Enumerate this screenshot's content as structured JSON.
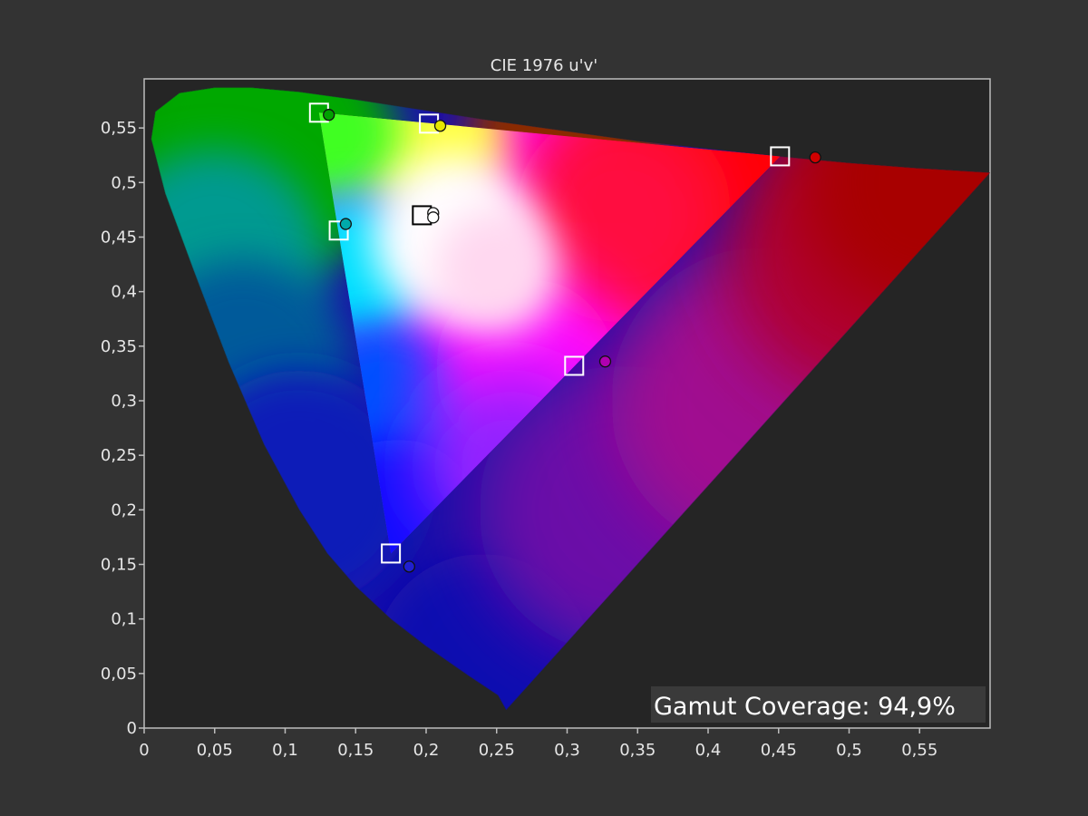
{
  "chart_data": {
    "type": "scatter",
    "title": "CIE 1976 u'v'",
    "xlabel": "",
    "ylabel": "",
    "xlim": [
      0,
      0.6
    ],
    "ylim": [
      0,
      0.595
    ],
    "x_ticks": [
      0,
      0.05,
      0.1,
      0.15,
      0.2,
      0.25,
      0.3,
      0.35,
      0.4,
      0.45,
      0.5,
      0.55
    ],
    "y_ticks": [
      0,
      0.05,
      0.1,
      0.15,
      0.2,
      0.25,
      0.3,
      0.35,
      0.4,
      0.45,
      0.5,
      0.55
    ],
    "x_tick_labels": [
      "0",
      "0,05",
      "0,1",
      "0,15",
      "0,2",
      "0,25",
      "0,3",
      "0,35",
      "0,4",
      "0,45",
      "0,5",
      "0,55"
    ],
    "y_tick_labels": [
      "0",
      "0,05",
      "0,1",
      "0,15",
      "0,2",
      "0,25",
      "0,3",
      "0,35",
      "0,4",
      "0,45",
      "0,5",
      "0,55"
    ],
    "grid": false,
    "background_color": "#333333",
    "plot_background_color": "#252525",
    "spectral_locus": [
      [
        0.2568,
        0.0165
      ],
      [
        0.251,
        0.03
      ],
      [
        0.23,
        0.048
      ],
      [
        0.2,
        0.075
      ],
      [
        0.175,
        0.1
      ],
      [
        0.15,
        0.13
      ],
      [
        0.13,
        0.16
      ],
      [
        0.11,
        0.2
      ],
      [
        0.085,
        0.26
      ],
      [
        0.06,
        0.335
      ],
      [
        0.035,
        0.42
      ],
      [
        0.015,
        0.49
      ],
      [
        0.005,
        0.54
      ],
      [
        0.008,
        0.565
      ],
      [
        0.025,
        0.582
      ],
      [
        0.05,
        0.587
      ],
      [
        0.076,
        0.587
      ],
      [
        0.11,
        0.583
      ],
      [
        0.15,
        0.576
      ],
      [
        0.2,
        0.566
      ],
      [
        0.25,
        0.556
      ],
      [
        0.3,
        0.547
      ],
      [
        0.35,
        0.538
      ],
      [
        0.4,
        0.531
      ],
      [
        0.45,
        0.524
      ],
      [
        0.5,
        0.518
      ],
      [
        0.55,
        0.513
      ],
      [
        0.6,
        0.509
      ]
    ],
    "series": [
      {
        "marker": "square",
        "stroke": "#ffffff",
        "points": [
          {
            "label": "green",
            "u": 0.124,
            "v": 0.564,
            "color": "#00a000"
          },
          {
            "label": "yellow",
            "u": 0.202,
            "v": 0.554,
            "color": "#e6e600"
          },
          {
            "label": "red",
            "u": 0.451,
            "v": 0.524,
            "color": "#d40000"
          },
          {
            "label": "white",
            "u": 0.197,
            "v": 0.47,
            "color": "#ffffff"
          },
          {
            "label": "cyan",
            "u": 0.138,
            "v": 0.456,
            "color": "#00b4b4"
          },
          {
            "label": "magenta",
            "u": 0.305,
            "v": 0.332,
            "color": "#d000d0"
          },
          {
            "label": "blue",
            "u": 0.175,
            "v": 0.16,
            "color": "#1e1ed8"
          }
        ]
      },
      {
        "marker": "circle",
        "stroke": "#111111",
        "points": [
          {
            "label": "green",
            "u": 0.131,
            "v": 0.562,
            "color": "#00a000"
          },
          {
            "label": "yellow",
            "u": 0.21,
            "v": 0.552,
            "color": "#e6e600"
          },
          {
            "label": "red",
            "u": 0.476,
            "v": 0.523,
            "color": "#d00000"
          },
          {
            "label": "white",
            "u": 0.205,
            "v": 0.472,
            "color": "#ffffff"
          },
          {
            "label": "white2",
            "u": 0.205,
            "v": 0.468,
            "color": "#ffffff"
          },
          {
            "label": "cyan",
            "u": 0.143,
            "v": 0.462,
            "color": "#00aaaa"
          },
          {
            "label": "magenta",
            "u": 0.327,
            "v": 0.336,
            "color": "#b000b0"
          },
          {
            "label": "blue",
            "u": 0.188,
            "v": 0.148,
            "color": "#2020d0"
          }
        ]
      }
    ],
    "annotation": {
      "text": "Gamut Coverage:  94,9%",
      "background": "#3a3a3a",
      "color": "#ffffff"
    }
  }
}
